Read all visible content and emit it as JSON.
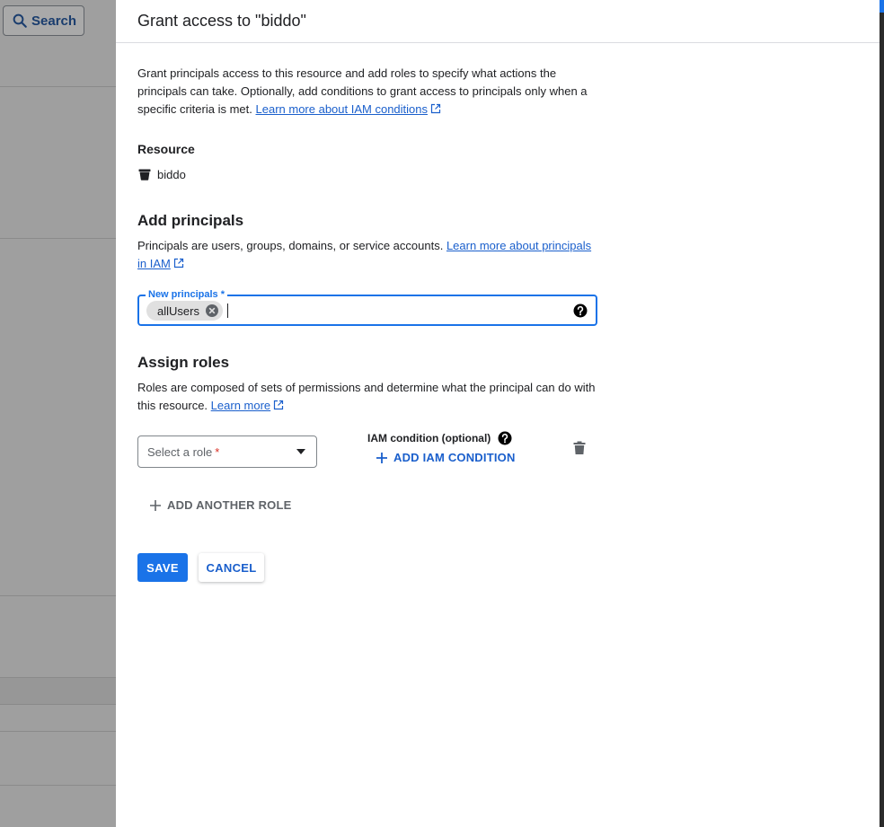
{
  "background": {
    "search_label": "Search"
  },
  "panel": {
    "title": "Grant access to \"biddo\"",
    "intro_text": "Grant principals access to this resource and add roles to specify what actions the principals can take. Optionally, add conditions to grant access to principals only when a specific criteria is met.",
    "intro_link": "Learn more about IAM conditions",
    "resource": {
      "label": "Resource",
      "name": "biddo",
      "icon": "bucket-icon"
    },
    "principals": {
      "heading": "Add principals",
      "description": "Principals are users, groups, domains, or service accounts.",
      "link": "Learn more about principals in IAM",
      "field_label": "New principals *",
      "chips": [
        "allUsers"
      ],
      "input_value": ""
    },
    "roles": {
      "heading": "Assign roles",
      "description": "Roles are composed of sets of permissions and determine what the principal can do with this resource.",
      "link": "Learn more",
      "select_placeholder": "Select a role",
      "required_mark": "*",
      "iam_condition_label": "IAM condition (optional)",
      "add_iam_condition": "ADD IAM CONDITION",
      "add_another_role": "ADD ANOTHER ROLE"
    },
    "actions": {
      "save": "SAVE",
      "cancel": "CANCEL"
    }
  },
  "colors": {
    "primary": "#1a73e8",
    "link": "#1a5fcc",
    "required": "#d93025"
  }
}
